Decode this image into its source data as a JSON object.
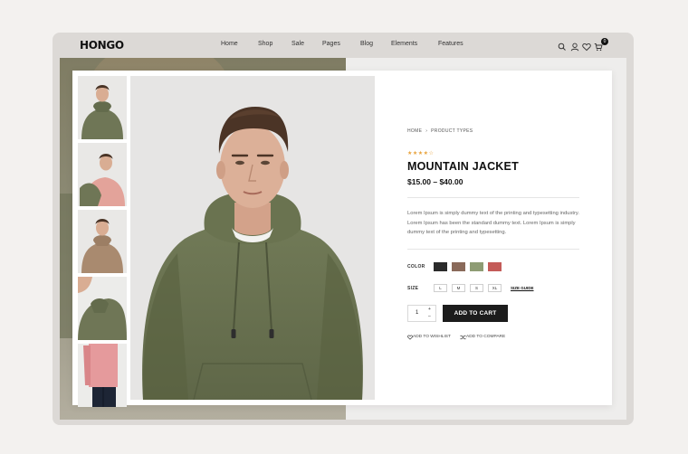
{
  "header": {
    "logo": "HONGO",
    "nav": [
      "Home",
      "Shop",
      "Sale",
      "Pages",
      "Blog",
      "Elements",
      "Features"
    ],
    "cart_count": "0",
    "icons": [
      "search-icon",
      "user-icon",
      "heart-icon",
      "cart-icon"
    ]
  },
  "product": {
    "breadcrumb": [
      "HOME",
      "PRODUCT TYPES"
    ],
    "rating": 4,
    "stars": "★★★★☆",
    "title": "MOUNTAIN JACKET",
    "price": "$15.00 – $40.00",
    "description": "Lorem Ipsum is simply dummy text of the printing and typesetting industry. Lorem Ipsum has been the standard dummy text. Lorem Ipsum is simply dummy text of the printing and typesetting.",
    "color_label": "COLOR",
    "colors": [
      "#2b2b2b",
      "#8a6a5a",
      "#8e9c74",
      "#c45b58"
    ],
    "size_label": "SIZE",
    "sizes": [
      "L",
      "M",
      "S",
      "XL"
    ],
    "size_guide": "SIZE GUIDE",
    "quantity": "1",
    "add_to_cart": "ADD TO CART",
    "wishlist": "ADD TO WISHLIST",
    "compare": "ADD TO COMPARE"
  },
  "colors": {
    "accent": "#e8a33d",
    "button": "#1c1c1c",
    "hoodie_green": "#6f7656"
  }
}
